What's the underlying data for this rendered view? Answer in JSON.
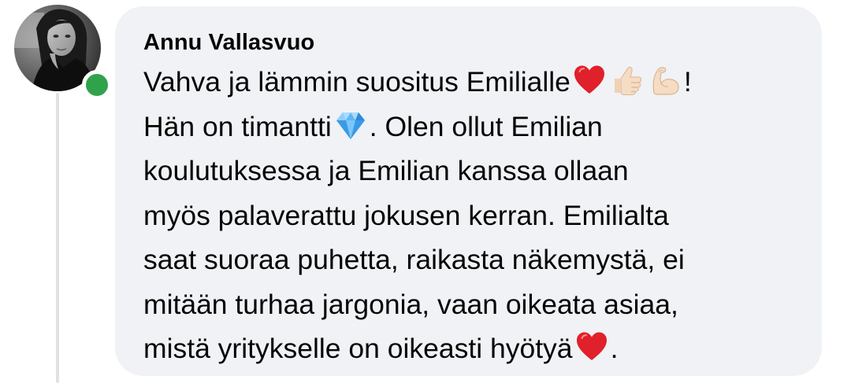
{
  "comment": {
    "author": "Annu Vallasvuo",
    "lines": [
      {
        "before": "Vahva ja lämmin suositus Emilialle",
        "after": "!"
      },
      {
        "before": "Hän on timantti",
        "after": ". Olen ollut Emilian"
      },
      {
        "text": "koulutuksessa  ja Emilian kanssa ollaan"
      },
      {
        "text": "myös palaverattu jokusen kerran. Emilialta"
      },
      {
        "text": "saat suoraa puhetta, raikasta näkemystä, ei"
      },
      {
        "text": "mitään turhaa jargonia, vaan oikeata asiaa,"
      },
      {
        "before": "mistä yritykselle on oikeasti hyötyä",
        "after": "."
      }
    ],
    "emojis": {
      "line1": [
        "red-heart",
        "thumbs-up-light-skin",
        "flexed-biceps-light-skin"
      ],
      "line2": [
        "gem-stone"
      ],
      "line7": [
        "red-heart"
      ]
    }
  },
  "status": {
    "online": true,
    "online_color": "#31a24c"
  },
  "colors": {
    "bubble_bg": "#f0f2f5",
    "text": "#050505"
  }
}
